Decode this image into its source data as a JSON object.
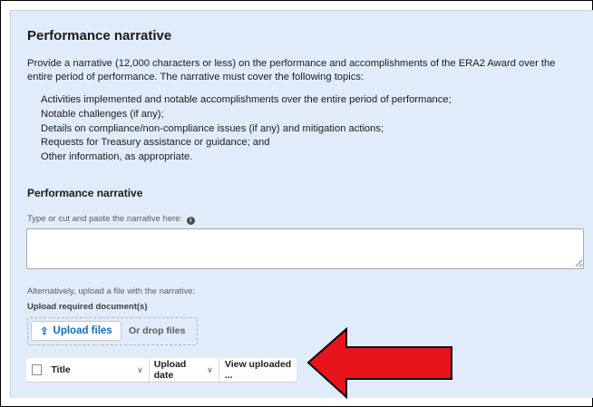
{
  "section": {
    "heading": "Performance narrative",
    "intro": "Provide a narrative (12,000 characters or less) on the performance and accomplishments of the ERA2 Award over the entire period of performance. The narrative must cover the following topics:",
    "topics": [
      "Activities implemented and notable accomplishments over the entire period of performance;",
      "Notable challenges (if any);",
      "Details on compliance/non-compliance issues (if any) and mitigation actions;",
      "Requests for Treasury assistance or guidance; and",
      "Other information, as appropriate."
    ],
    "subheading": "Performance narrative",
    "field_label": "Type or cut and paste the narrative here:",
    "info_icon_glyph": "i",
    "narrative_value": "",
    "alt_label": "Alternatively, upload a file with the narrative:",
    "upload_label": "Upload required document(s)",
    "upload_button": "Upload files",
    "drop_text": "Or drop files"
  },
  "table": {
    "columns": [
      "Title",
      "Upload date",
      "View uploaded ..."
    ]
  },
  "icons": {
    "upload": "upload-icon",
    "chevron": "chevron-down-icon",
    "info": "info-icon"
  },
  "colors": {
    "panel_bg": "#e1ecfa",
    "accent": "#0b6bcb",
    "annotation_arrow": "#e8141c"
  }
}
